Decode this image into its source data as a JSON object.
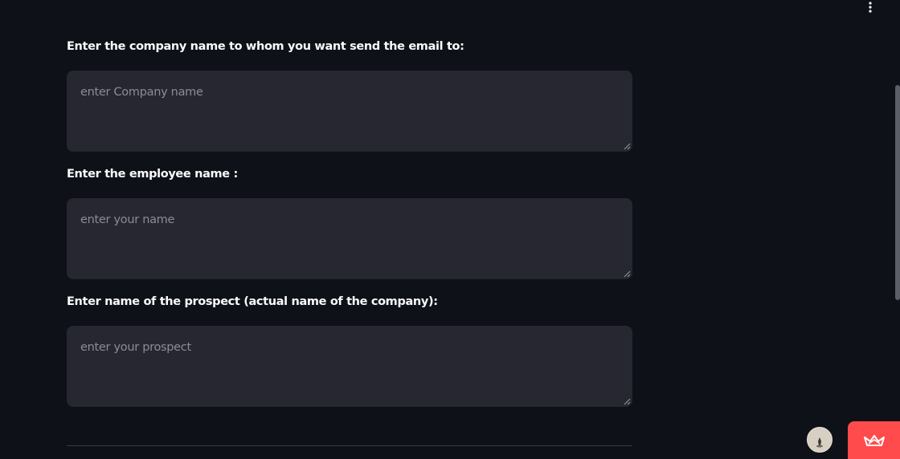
{
  "header": {
    "menu_icon": "vertical-ellipsis-icon"
  },
  "form": {
    "fields": [
      {
        "label": "Enter the company name to whom you want send the email to:",
        "value": "",
        "placeholder": "enter Company name"
      },
      {
        "label": "Enter the employee name :",
        "value": "",
        "placeholder": "enter your name"
      },
      {
        "label": "Enter name of the prospect (actual name of the company):",
        "value": "",
        "placeholder": "enter your prospect"
      }
    ]
  },
  "footer": {
    "avatar_icon": "user-avatar-icon",
    "badge_icon": "streamlit-crown-icon"
  },
  "colors": {
    "background": "#0e1117",
    "input_background": "#262730",
    "accent": "#ff4b4b",
    "text": "#fafafa",
    "placeholder": "#8b8d94"
  }
}
